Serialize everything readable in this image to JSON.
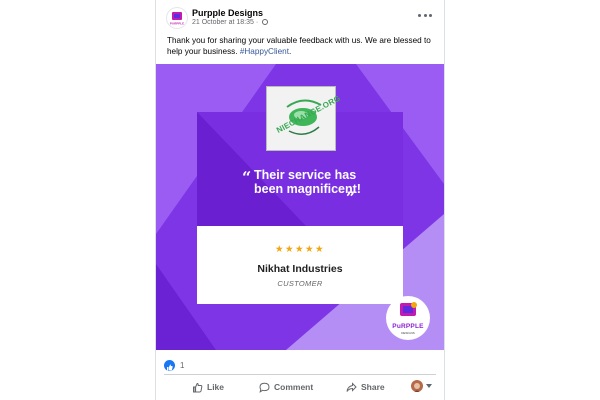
{
  "post": {
    "page_name": "Purpple Designs",
    "timestamp": "21 October at 18:35 ·",
    "privacy_icon": "globe-icon",
    "caption_text": "Thank you for sharing your valuable feedback with us. We are blessed to help your business. ",
    "hashtag": "#HappyClient",
    "hashtag_suffix": "."
  },
  "image": {
    "stamp_text": "NIECHANGE.ORG",
    "quote": "Their service has been magnificent!",
    "rating_stars": "★★★★★",
    "rating": 5,
    "customer_name": "Nikhat Industries",
    "customer_role": "CUSTOMER",
    "logo_word": "PuRPPLE",
    "logo_sub": "DESIGNS",
    "colors": {
      "purple_dark": "#6a1fd0",
      "purple_mid": "#8a3ff0",
      "purple_light": "#b68cf5",
      "star": "#f2a60f"
    }
  },
  "reactions": {
    "count": "1",
    "icon": "like-icon"
  },
  "actions": {
    "like_label": "Like",
    "comment_label": "Comment",
    "share_label": "Share"
  },
  "colors": {
    "link": "#385898",
    "like_blue": "#1877f2",
    "muted": "#65676b"
  }
}
